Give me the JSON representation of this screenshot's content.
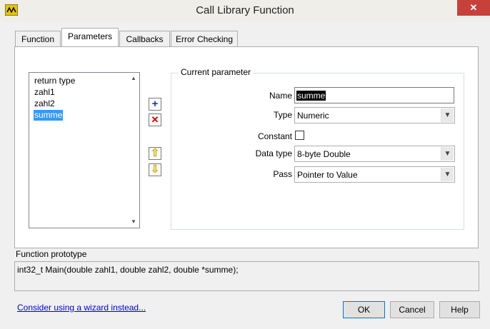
{
  "window": {
    "title": "Call Library Function",
    "close_glyph": "✕"
  },
  "tabs": [
    {
      "label": "Function"
    },
    {
      "label": "Parameters"
    },
    {
      "label": "Callbacks"
    },
    {
      "label": "Error Checking"
    }
  ],
  "active_tab": "Parameters",
  "parameters_list": {
    "items": [
      {
        "label": "return type"
      },
      {
        "label": "zahl1"
      },
      {
        "label": "zahl2"
      },
      {
        "label": "summe"
      }
    ],
    "selected": "summe"
  },
  "icon_buttons": {
    "add_glyph": "+",
    "delete_glyph": "✕",
    "up_glyph": "⇧",
    "down_glyph": "⇩"
  },
  "current_parameter": {
    "group_label": "Current parameter",
    "name_label": "Name",
    "name_value": "summe",
    "type_label": "Type",
    "type_value": "Numeric",
    "constant_label": "Constant",
    "constant_checked": false,
    "data_type_label": "Data type",
    "data_type_value": "8-byte Double",
    "pass_label": "Pass",
    "pass_value": "Pointer to Value"
  },
  "function_prototype": {
    "label": "Function prototype",
    "text": "int32_t Main(double zahl1, double zahl2, double *summe);"
  },
  "footer": {
    "wizard_link": "Consider using a wizard instead...",
    "ok_label": "OK",
    "cancel_label": "Cancel",
    "help_label": "Help"
  },
  "colors": {
    "selection": "#3399ff",
    "link": "#0000d8",
    "close_button": "#c7413a",
    "add_icon": "#1a3a9a",
    "delete_icon": "#d00000",
    "arrow_icon": "#d8c400"
  }
}
